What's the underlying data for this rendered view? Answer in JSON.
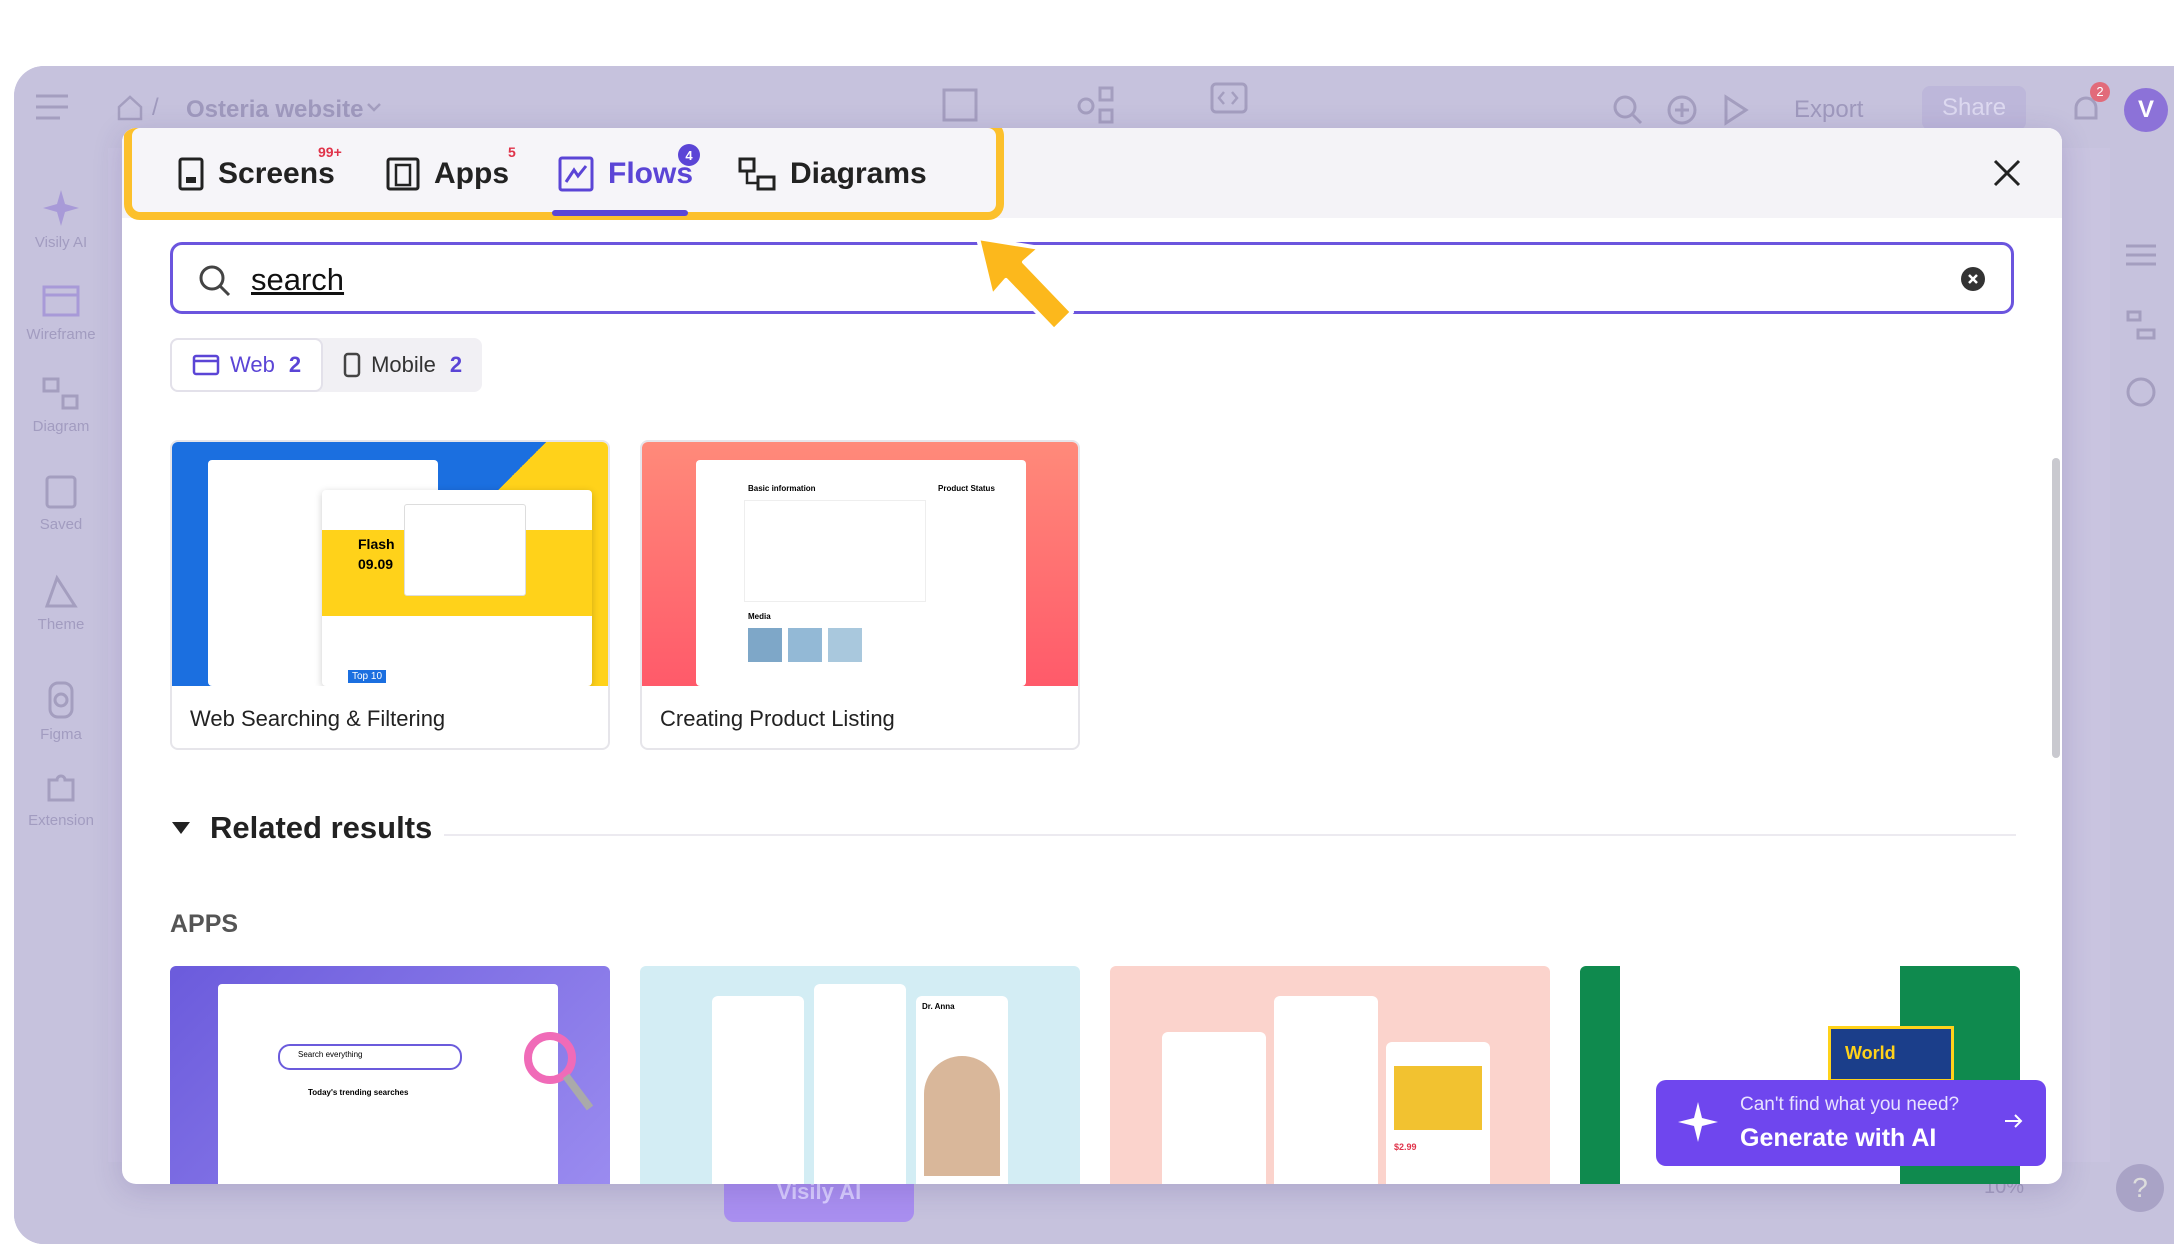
{
  "app": {
    "breadcrumb_project": "Osteria website",
    "topbar": {
      "export_label": "Export",
      "share_label": "Share",
      "notification_count": "2",
      "avatar_letter": "V"
    },
    "sidebar": [
      {
        "label": "Visily AI",
        "icon": "sparkle-icon"
      },
      {
        "label": "Wireframe",
        "icon": "wireframe-icon"
      },
      {
        "label": "Diagram",
        "icon": "diagram-icon"
      },
      {
        "label": "Saved",
        "icon": "saved-icon"
      },
      {
        "label": "Theme",
        "icon": "theme-icon"
      },
      {
        "label": "Figma",
        "icon": "figma-icon"
      },
      {
        "label": "Extension",
        "icon": "extension-icon"
      }
    ],
    "bottombar": {
      "visily_ai_label": "Visily AI",
      "zoom": "10%"
    }
  },
  "modal": {
    "tabs": [
      {
        "label": "Screens",
        "badge": "99+",
        "icon": "screen-icon"
      },
      {
        "label": "Apps",
        "badge": "5",
        "icon": "apps-icon"
      },
      {
        "label": "Flows",
        "badge": "4",
        "icon": "flows-icon"
      },
      {
        "label": "Diagrams",
        "badge": "",
        "icon": "diagrams-icon"
      }
    ],
    "active_tab": "Flows",
    "search": {
      "value": "search"
    },
    "platform_filter": [
      {
        "label": "Web",
        "count": "2"
      },
      {
        "label": "Mobile",
        "count": "2"
      }
    ],
    "results": [
      {
        "title": "Web Searching & Filtering",
        "thumb_text_1": "Flash",
        "thumb_text_2": "09.09",
        "thumb_text_3": "Top 10"
      },
      {
        "title": "Creating Product Listing",
        "thumb_text_1": "Basic information",
        "thumb_text_2": "Product Status",
        "thumb_text_3": "Media"
      }
    ],
    "related": {
      "title": "Related results",
      "apps_label": "APPS",
      "app_cards": [
        {
          "thumb_text": "Search everything",
          "thumb_text_2": "Today's trending searches"
        },
        {
          "thumb_text": "Dr. Anna"
        },
        {
          "thumb_text": "$2.99"
        },
        {
          "thumb_text": "World"
        }
      ]
    },
    "generate_ai": {
      "subtitle": "Can't find what you need?",
      "label": "Generate with AI"
    }
  },
  "colors": {
    "accent": "#5b45d6",
    "highlight": "#fcc02c",
    "ai_button": "#6f46ee",
    "badge_red": "#e0334a"
  }
}
